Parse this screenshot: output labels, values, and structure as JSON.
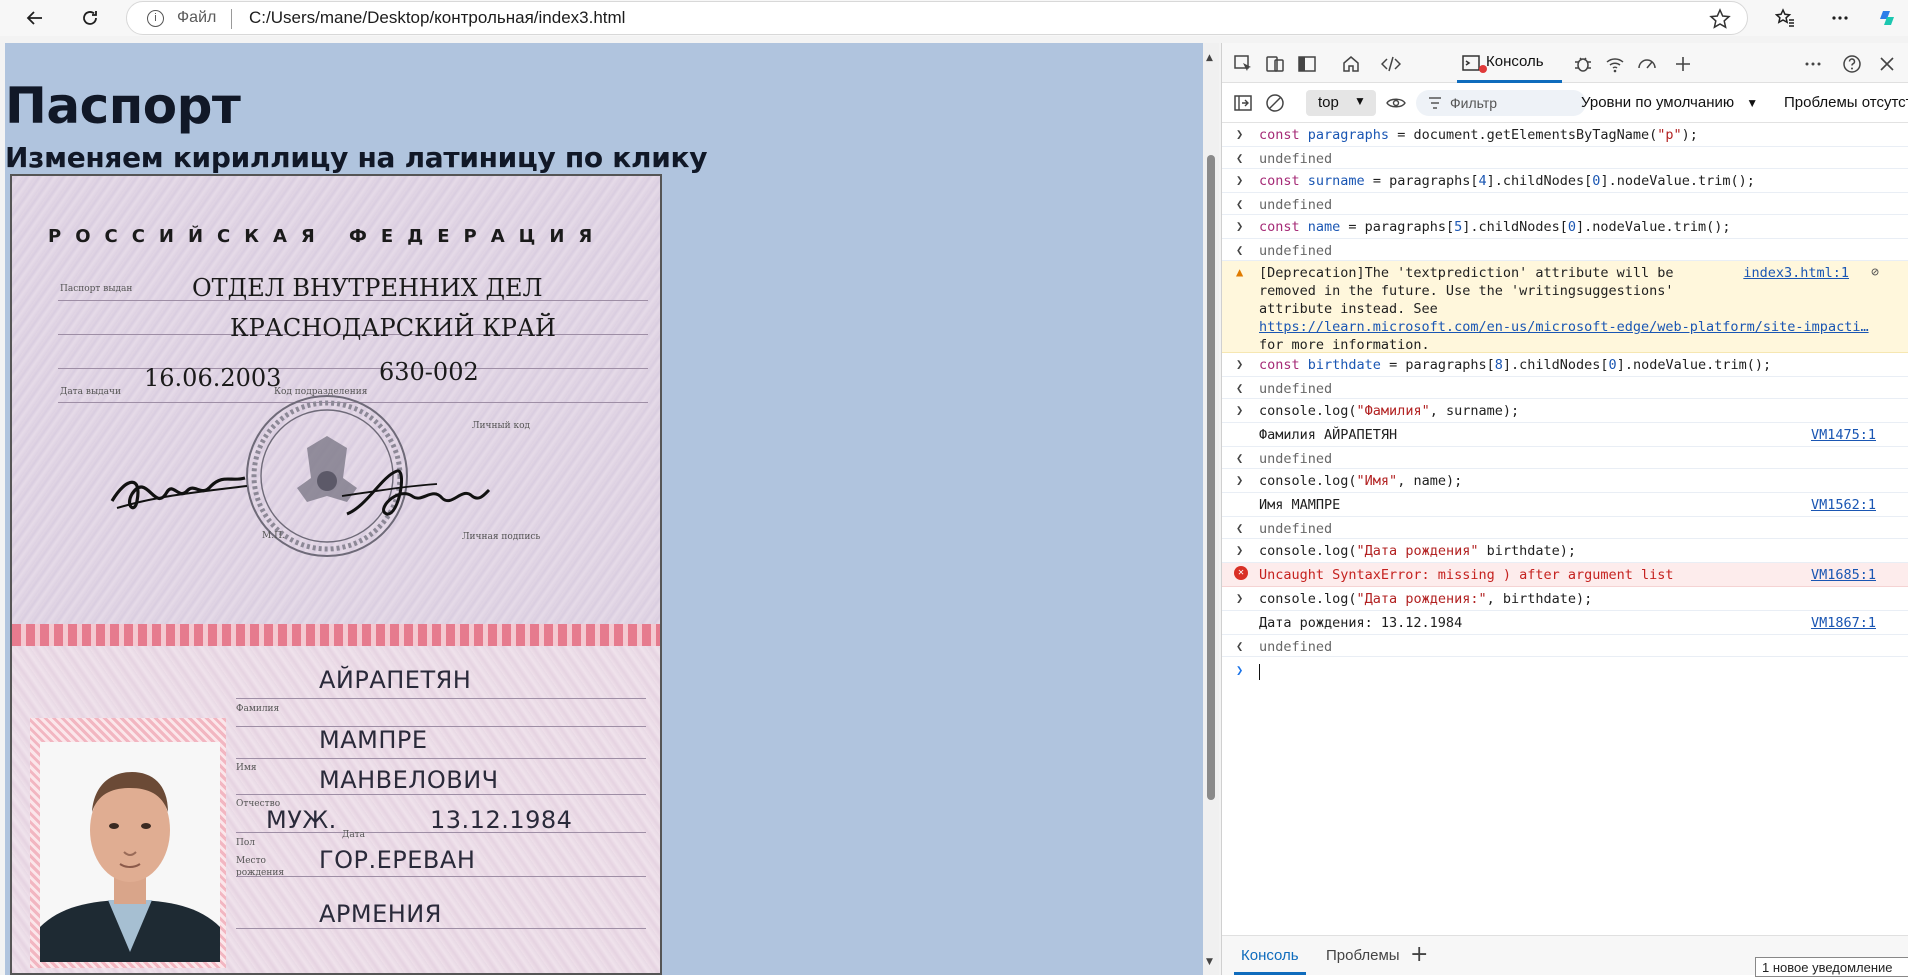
{
  "toolbar": {
    "address_file_label": "Файл",
    "address_url": "C:/Users/mane/Desktop/контрольная/index3.html"
  },
  "page": {
    "title": "Паспорт",
    "subtitle": "Изменяем кириллицу на латиницу по клику"
  },
  "passport": {
    "country": "РОССИЙСКАЯ ФЕДЕРАЦИЯ",
    "issued_by_line1": "ОТДЕЛ ВНУТРЕННИХ ДЕЛ",
    "issued_by_line2": "КРАСНОДАРСКИЙ   КРАЙ",
    "issue_date": "16.06.2003",
    "division_code": "630-002",
    "label_issued": "Паспорт выдан",
    "label_issue_date": "Дата выдачи",
    "label_division": "Код подразделения",
    "label_personal_code": "Личный код",
    "label_signature": "Личная подпись",
    "label_mp": "М.П.",
    "surname": "АЙРАПЕТЯН",
    "name": "МАМПРЕ",
    "patronymic": "МАНВЕЛОВИЧ",
    "sex": "МУЖ.",
    "birthdate": "13.12.1984",
    "birth_city": "ГОР.ЕРЕВАН",
    "birth_country": "АРМЕНИЯ",
    "label_surname": "Фамилия",
    "label_name": "Имя",
    "label_patronymic": "Отчество",
    "label_sex": "Пол",
    "label_birthdate": "Дата",
    "label_birthplace1": "Место",
    "label_birthplace2": "рождения"
  },
  "devtools": {
    "console_tab": "Консоль",
    "context": "top",
    "filter_placeholder": "Фильтр",
    "levels": "Уровни по умолчанию",
    "issues": "Проблемы отсутствуют",
    "drawer_console": "Консоль",
    "drawer_issues": "Проблемы",
    "toast": "1 новое уведомление"
  },
  "console": {
    "undefined": "undefined",
    "l1_pre": "const ",
    "l1_var": "paragraphs",
    "l1_mid": " = document.getElementsByTagName(",
    "l1_str": "\"p\"",
    "l1_end": ");",
    "l2_pre": "const ",
    "l2_var": "surname",
    "l2_mid": " = paragraphs[",
    "l2_n1": "4",
    "l2_mid2": "].childNodes[",
    "l2_n2": "0",
    "l2_end": "].nodeValue.trim();",
    "l3_pre": "const ",
    "l3_var": "name",
    "l3_mid": " = paragraphs[",
    "l3_n1": "5",
    "l3_mid2": "].childNodes[",
    "l3_n2": "0",
    "l3_end": "].nodeValue.trim();",
    "warn_1": "[Deprecation]The 'textprediction' attribute will be",
    "warn_2": "removed in the future. Use the 'writingsuggestions'",
    "warn_3": "attribute instead. See",
    "warn_link": "https://learn.microsoft.com/en-us/microsoft-edge/web-platform/site-impacti…",
    "warn_4": "for more information.",
    "warn_src": "index3.html:1",
    "l4_pre": "const ",
    "l4_var": "birthdate",
    "l4_mid": " = paragraphs[",
    "l4_n1": "8",
    "l4_mid2": "].childNodes[",
    "l4_n2": "0",
    "l4_end": "].nodeValue.trim();",
    "l5_pre": "console.log(",
    "l5_str": "\"Фамилия\"",
    "l5_end": ", surname);",
    "o5": "Фамилия АЙРАПЕТЯН",
    "o5_src": "VM1475:1",
    "l6_pre": "console.log(",
    "l6_str": "\"Имя\"",
    "l6_end": ", name);",
    "o6": "Имя МАМПРЕ",
    "o6_src": "VM1562:1",
    "l7_pre": "console.log(",
    "l7_str": "\"Дата рождения\"",
    "l7_end": " birthdate);",
    "e7": "Uncaught SyntaxError: missing ) after argument list",
    "e7_src": "VM1685:1",
    "l8_pre": "console.log(",
    "l8_str": "\"Дата рождения:\"",
    "l8_end": ", birthdate);",
    "o8": "Дата рождения: 13.12.1984",
    "o8_src": "VM1867:1"
  },
  "colors": {
    "page_background": "#b0c4de",
    "accent": "#0f6cbd",
    "error": "#c5221f",
    "warning_bg": "#fff7dc"
  }
}
